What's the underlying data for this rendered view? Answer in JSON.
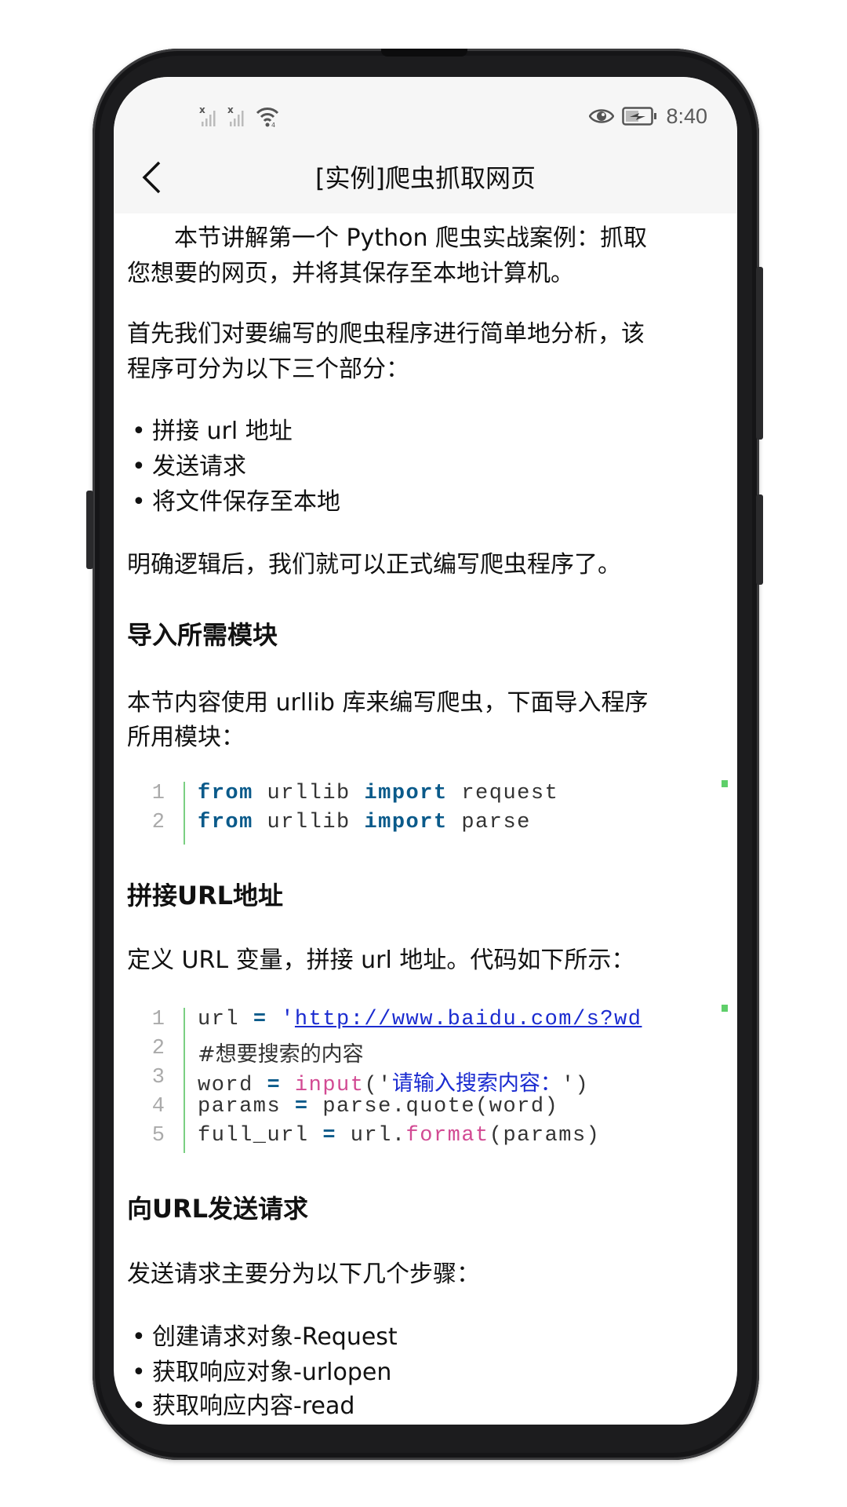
{
  "status_bar": {
    "left_icons": [
      "signal-no-sim-icon",
      "signal-no-sim-icon",
      "wifi-icon"
    ],
    "right_icons": [
      "eye-comfort-icon",
      "battery-charging-icon"
    ],
    "time": "8:40"
  },
  "header": {
    "back_icon": "chevron-left-icon",
    "title": "[实例]爬虫抓取网页"
  },
  "article": {
    "intro_line1": "本节讲解第一个 Python 爬虫实战案例：抓取",
    "intro_line2": "您想要的网页，并将其保存至本地计算机。",
    "analysis_line1": "首先我们对要编写的爬虫程序进行简单地分析，该",
    "analysis_line2": "程序可分为以下三个部分：",
    "parts": [
      "拼接 url 地址",
      "发送请求",
      "将文件保存至本地"
    ],
    "summary": "明确逻辑后，我们就可以正式编写爬虫程序了。",
    "section1": {
      "heading": "导入所需模块",
      "text_line1": "本节内容使用 urllib 库来编写爬虫，下面导入程序",
      "text_line2": "所用模块：",
      "code": [
        {
          "num": "1",
          "kw1": "from",
          "mod": " urllib ",
          "kw2": "import",
          "name": " request"
        },
        {
          "num": "2",
          "kw1": "from",
          "mod": " urllib ",
          "kw2": "import",
          "name": " parse"
        }
      ]
    },
    "section2": {
      "heading": "拼接URL地址",
      "text": "定义 URL 变量，拼接 url 地址。代码如下所示：",
      "code": {
        "line_numbers": [
          "1",
          "2",
          "3",
          "4",
          "5"
        ],
        "l1_var": "url ",
        "l1_op": "=",
        "l1_quote": " '",
        "l1_link": "http://www.baidu.com/s?wd",
        "l2_comment": "#想要搜索的内容",
        "l3_var": "word ",
        "l3_op": "=",
        "l3_fn": " input",
        "l3_open": "('",
        "l3_str": "请输入搜索内容：",
        "l3_close": "')",
        "l4_var": "params ",
        "l4_op": "=",
        "l4_rest": " parse.quote(word)",
        "l5_var": "full_url ",
        "l5_op": "=",
        "l5_obj": " url.",
        "l5_fn": "format",
        "l5_rest": "(params)"
      }
    },
    "section3": {
      "heading": "向URL发送请求",
      "text": "发送请求主要分为以下几个步骤：",
      "steps": [
        "创建请求对象-Request",
        "获取响应对象-urlopen",
        "获取响应内容-read"
      ]
    }
  }
}
